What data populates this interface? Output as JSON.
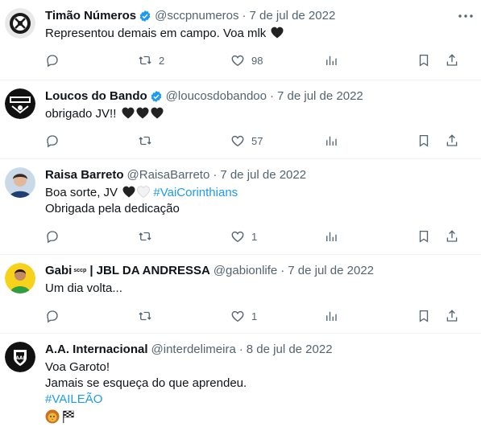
{
  "tweets": [
    {
      "name": "Timão Números",
      "verified": true,
      "handle": "@sccpnumeros",
      "date": "7 de jul de 2022",
      "lines": [
        "Representou demais em campo. Voa mlk"
      ],
      "hearts_line1": [
        "black"
      ],
      "reply_count": "",
      "retweet_count": "2",
      "like_count": "98"
    },
    {
      "name": "Loucos do Bando",
      "verified": true,
      "handle": "@loucosdobandoo",
      "date": "7 de jul de 2022",
      "lines": [
        "obrigado JV!!"
      ],
      "hearts_line1": [
        "black",
        "black",
        "black"
      ],
      "reply_count": "",
      "retweet_count": "",
      "like_count": "57"
    },
    {
      "name": "Raisa Barreto",
      "verified": false,
      "handle": "@RaisaBarreto",
      "date": "7 de jul de 2022",
      "line1_prefix": "Boa sorte, JV",
      "hearts_line1": [
        "black",
        "white"
      ],
      "hashtag": "#VaiCorinthians",
      "lines": [
        "Obrigada pela dedicação"
      ],
      "reply_count": "",
      "retweet_count": "",
      "like_count": "1"
    },
    {
      "name": "Gabi",
      "name_sup": "sccp",
      "name_suffix": "| JBL DA ANDRESSA",
      "verified": false,
      "handle": "@gabionlife",
      "date": "7 de jul de 2022",
      "lines": [
        "Um dia volta..."
      ],
      "reply_count": "",
      "retweet_count": "",
      "like_count": "1"
    },
    {
      "name": "A.A. Internacional",
      "verified": false,
      "handle": "@interdelimeira",
      "date": "8 de jul de 2022",
      "lines": [
        "Voa Garoto!",
        "Jamais se esqueça do que aprendeu."
      ],
      "hashtag": "#VAILEÃO",
      "emojis": [
        "lion-emoji",
        "checkered-flag-emoji"
      ]
    }
  ],
  "separator": "·",
  "colors": {
    "text": "#0f1419",
    "muted": "#536471",
    "link": "#1d9bf0",
    "verified": "#1d9bf0",
    "border": "#eff3f4"
  }
}
